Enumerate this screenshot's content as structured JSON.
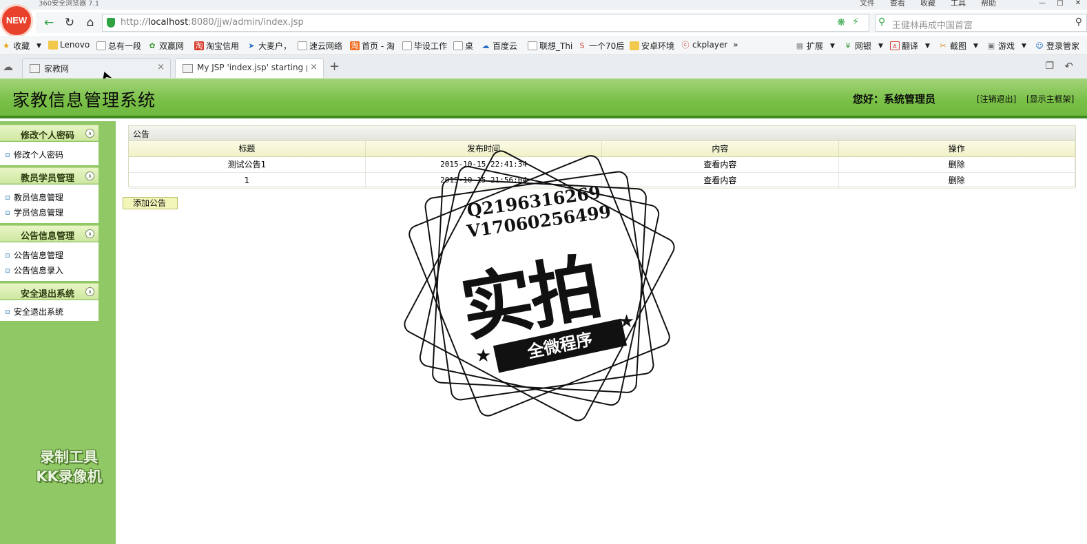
{
  "browser": {
    "window_title": "360安全浏览器 7.1",
    "logo_text": "NEW",
    "menus": [
      "文件",
      "查看",
      "收藏",
      "工具",
      "帮助"
    ],
    "url_prefix": "http://",
    "url_host": "localhost",
    "url_rest": ":8080/jjw/admin/index.jsp",
    "search_placeholder": "王健林再成中国首富",
    "bookmarks": [
      "收藏",
      "Lenovo",
      "总有一段",
      "双赢网",
      "淘宝信用",
      "大麦户，",
      "速云网络",
      "首页 - 淘",
      "毕设工作",
      "桌",
      "百度云",
      "联想_Thi",
      "一个70后",
      "安卓环境",
      "ckplayer"
    ],
    "toolbar_right": [
      "扩展",
      "网银",
      "翻译",
      "截图",
      "游戏",
      "登录管家"
    ],
    "tabs": [
      {
        "label": "家教网"
      },
      {
        "label": "My JSP 'index.jsp' starting page"
      }
    ]
  },
  "header": {
    "system_title": "家教信息管理系统",
    "greeting": "您好：系统管理员",
    "logout_link": "[注销退出]",
    "main_frame_link": "[显示主框架]"
  },
  "sidebar": {
    "groups": [
      {
        "title": "修改个人密码",
        "items": [
          "修改个人密码"
        ]
      },
      {
        "title": "教员学员管理",
        "items": [
          "教员信息管理",
          "学员信息管理"
        ]
      },
      {
        "title": "公告信息管理",
        "items": [
          "公告信息管理",
          "公告信息录入"
        ]
      },
      {
        "title": "安全退出系统",
        "items": [
          "安全退出系统"
        ]
      }
    ],
    "watermark_line1": "录制工具",
    "watermark_line2": "KK录像机"
  },
  "main": {
    "panel_title": "公告",
    "columns": [
      "标题",
      "发布时间",
      "内容",
      "操作"
    ],
    "rows": [
      {
        "title": "测试公告1",
        "time": "2015-10-15 22:41:34",
        "content": "查看内容",
        "action": "删除"
      },
      {
        "title": "1",
        "time": "2015-10-15 21:56:04",
        "content": "查看内容",
        "action": "删除"
      }
    ],
    "add_button": "添加公告"
  },
  "stamp": {
    "line1": "Q2196316269",
    "line2": "V17060256499",
    "big_text": "实拍",
    "ribbon_text": "全微程序"
  }
}
